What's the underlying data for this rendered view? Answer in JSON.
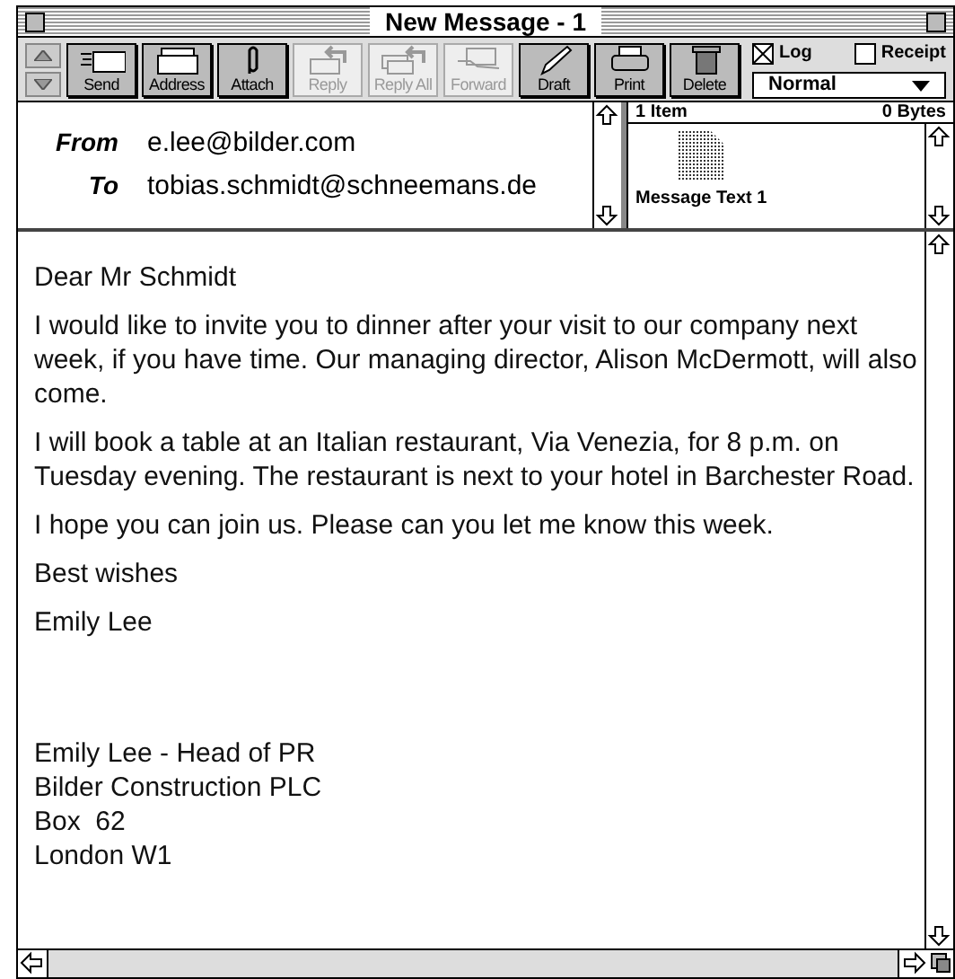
{
  "window": {
    "title": "New Message - 1"
  },
  "toolbar": {
    "buttons": [
      {
        "kind": "send",
        "label": "Send",
        "disabled": false
      },
      {
        "kind": "address",
        "label": "Address",
        "disabled": false
      },
      {
        "kind": "attach",
        "label": "Attach",
        "disabled": false
      },
      {
        "kind": "reply",
        "label": "Reply",
        "disabled": true
      },
      {
        "kind": "replyall",
        "label": "Reply All",
        "disabled": true
      },
      {
        "kind": "forward",
        "label": "Forward",
        "disabled": true
      },
      {
        "kind": "draft",
        "label": "Draft",
        "disabled": false
      },
      {
        "kind": "print",
        "label": "Print",
        "disabled": false
      },
      {
        "kind": "delete",
        "label": "Delete",
        "disabled": false
      }
    ],
    "options": [
      {
        "label": "Log",
        "checked": true
      },
      {
        "label": "Receipt",
        "checked": false
      }
    ],
    "priority": "Normal"
  },
  "header": {
    "fields": [
      {
        "label": "From",
        "value": "e.lee@bilder.com"
      },
      {
        "label": "To",
        "value": "tobias.schmidt@schneemans.de"
      }
    ]
  },
  "attachments": {
    "count": "1 Item",
    "size": "0 Bytes",
    "items": [
      "Message Text 1"
    ]
  },
  "body": {
    "paragraphs": [
      "Dear Mr Schmidt",
      "I would like to invite you to dinner after your visit to our company next week, if you have time. Our managing director, Alison McDermott, will also come.",
      "I will book a table at an Italian restaurant, Via Venezia, for 8 p.m. on Tuesday evening. The restaurant is next to your hotel in Barchester Road.",
      "I hope you can join us. Please can you let me know this week.",
      "Best wishes",
      "Emily Lee"
    ],
    "signature": [
      "Emily Lee - Head of PR",
      "Bilder Construction PLC",
      "Box  62",
      "London W1"
    ]
  }
}
